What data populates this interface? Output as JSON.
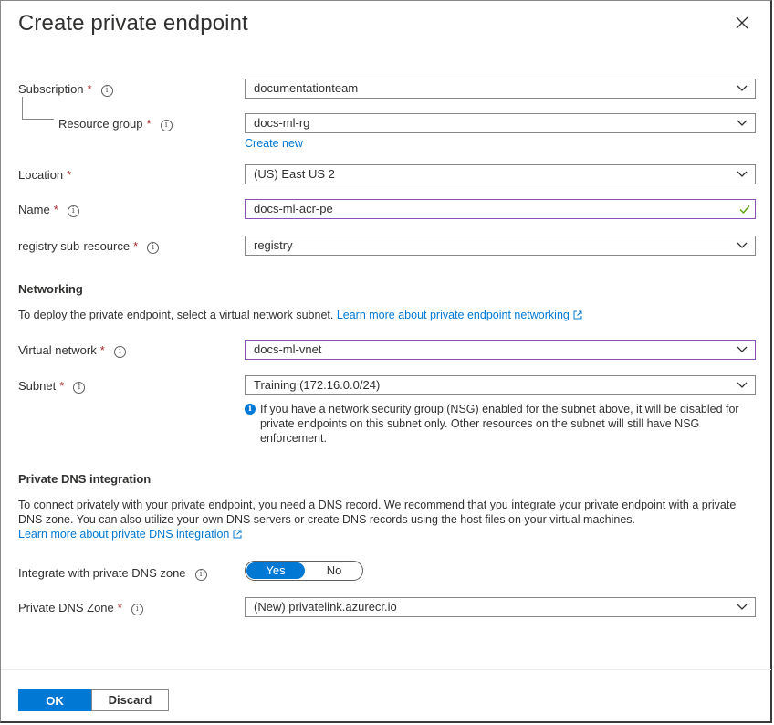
{
  "dialog": {
    "title": "Create private endpoint",
    "close_icon": "close-icon"
  },
  "form": {
    "subscription": {
      "label": "Subscription",
      "value": "documentationteam"
    },
    "resource_group": {
      "label": "Resource group",
      "value": "docs-ml-rg",
      "create_new": "Create new"
    },
    "location": {
      "label": "Location",
      "value": "(US) East US 2"
    },
    "name": {
      "label": "Name",
      "value": "docs-ml-acr-pe"
    },
    "sub_resource": {
      "label": "registry sub-resource",
      "value": "registry"
    }
  },
  "networking": {
    "heading": "Networking",
    "description": "To deploy the private endpoint, select a virtual network subnet.",
    "learn_more": "Learn more about private endpoint networking",
    "virtual_network": {
      "label": "Virtual network",
      "value": "docs-ml-vnet"
    },
    "subnet": {
      "label": "Subnet",
      "value": "Training (172.16.0.0/24)"
    },
    "nsg_note": "If you have a network security group (NSG) enabled for the subnet above, it will be disabled for private endpoints on this subnet only. Other resources on the subnet will still have NSG enforcement."
  },
  "dns": {
    "heading": "Private DNS integration",
    "description": "To connect privately with your private endpoint, you need a DNS record. We recommend that you integrate your private endpoint with a private DNS zone. You can also utilize your own DNS servers or create DNS records using the host files on your virtual machines.",
    "learn_more": "Learn more about private DNS integration",
    "integrate": {
      "label": "Integrate with private DNS zone",
      "yes": "Yes",
      "no": "No",
      "selected": "Yes"
    },
    "zone": {
      "label": "Private DNS Zone",
      "value": "(New) privatelink.azurecr.io"
    }
  },
  "footer": {
    "ok_label": "OK",
    "discard_label": "Discard"
  },
  "colors": {
    "accent": "#0078d4",
    "required": "#a4262c",
    "valid_check": "#57a300",
    "focus_border": "#8a4fb8"
  }
}
